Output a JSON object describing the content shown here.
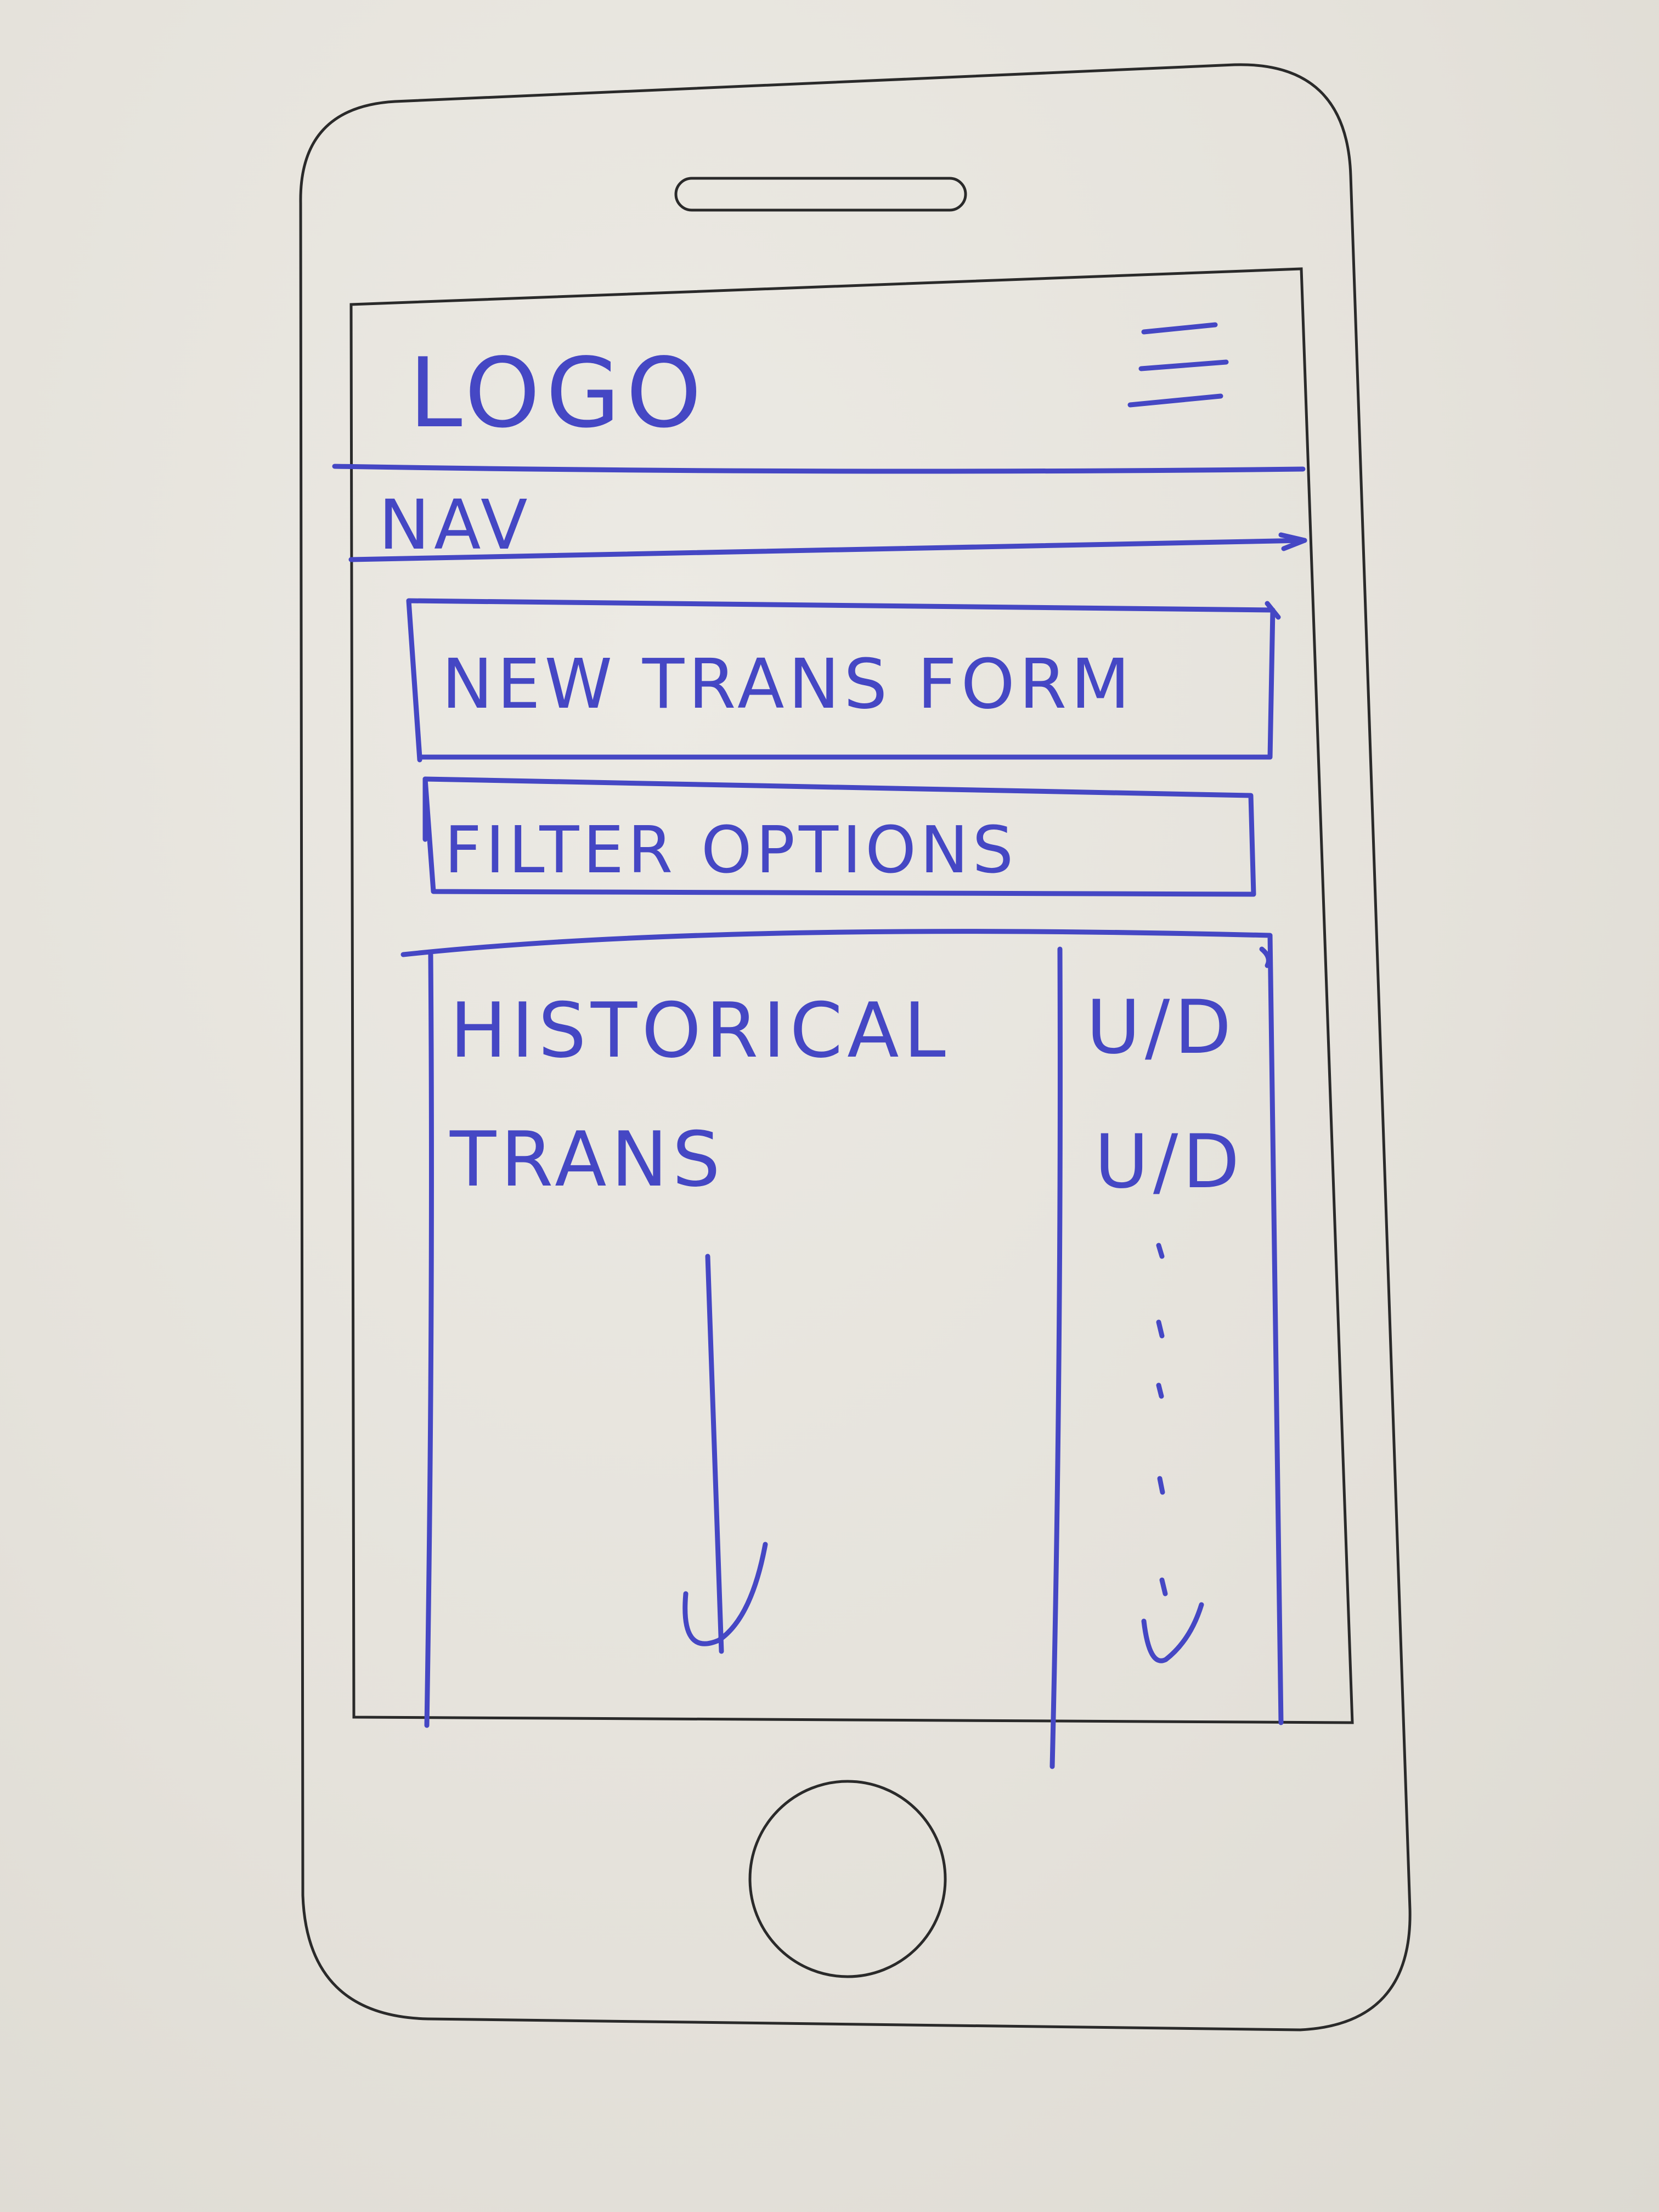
{
  "header": {
    "logo_text": "LOGO",
    "menu_icon": "hamburger-menu-icon"
  },
  "nav": {
    "label": "NAV"
  },
  "new_transaction_form": {
    "label": "NEW TRANS FORM"
  },
  "filter_options": {
    "label": "FILTER OPTIONS"
  },
  "transactions_list": {
    "label_line1": "HISTORICAL",
    "label_line2": "TRANS",
    "scroll_icon": "down-arrow-icon"
  },
  "row_actions": {
    "items": [
      "U/D",
      "U/D"
    ],
    "more_icon": "dotted-down-arrow-icon"
  },
  "style": {
    "ink_color": "#4547c4",
    "outline_color": "#2a2a2a",
    "paper_color": "#e4e1da"
  }
}
